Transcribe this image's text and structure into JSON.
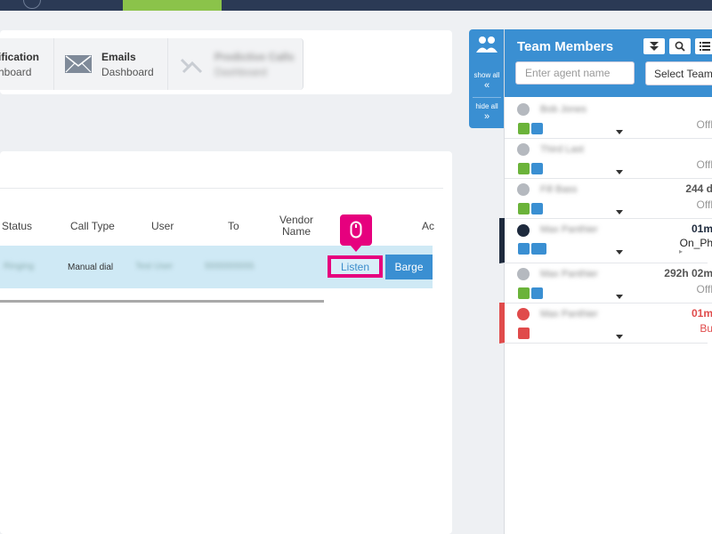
{
  "dashboards": {
    "notifications": {
      "title": "ification",
      "subtitle": "hboard"
    },
    "emails": {
      "title": "Emails",
      "subtitle": "Dashboard"
    },
    "predictive": {
      "title": "Predictive Calls",
      "subtitle": "Dashboard"
    }
  },
  "table": {
    "headers": {
      "status": "Status",
      "call_type": "Call Type",
      "user": "User",
      "to": "To",
      "vendor_name": "Vendor Name",
      "actions": "Ac"
    },
    "row": {
      "status": "Ringing",
      "call_type": "Manual dial",
      "user": "Test User",
      "to": "5555555555"
    },
    "listen_label": "Listen",
    "barge_label": "Barge"
  },
  "side_strip": {
    "show_all": "show all",
    "hide_all": "hide all",
    "show_arrow": "«",
    "hide_arrow": "»"
  },
  "team": {
    "title": "Team Members",
    "search_placeholder": "Enter agent name",
    "select_teams": "Select Teams",
    "members": [
      {
        "name": "Bob Jones",
        "time": "",
        "status": "Offl"
      },
      {
        "name": "Third Last",
        "time": "",
        "status": "Offl"
      },
      {
        "name": "Fill Bass",
        "time": "244 d",
        "status": "Offl"
      },
      {
        "name": "Max Panthier",
        "time": "01m",
        "status": "On_Ph"
      },
      {
        "name": "Max Panthier",
        "time": "292h 02m",
        "status": "Offl"
      },
      {
        "name": "Max Panthier",
        "time": "01m",
        "status": "Bu"
      }
    ]
  },
  "colors": {
    "accent": "#3a8fd2",
    "highlight": "#e6007e",
    "topbar": "#2b3a55",
    "topbar_green": "#8bc34a",
    "busy": "#e04b4b",
    "online": "#6bb33a"
  }
}
